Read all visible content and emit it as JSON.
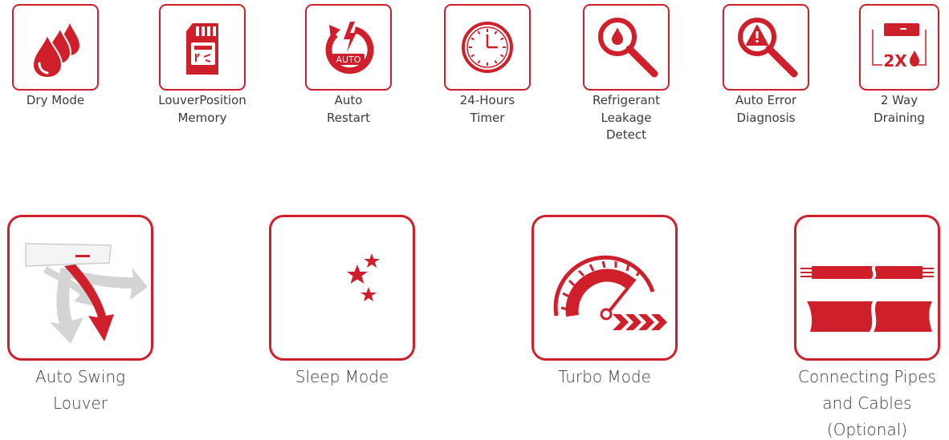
{
  "colors": {
    "accent": "#cf1f2b",
    "text": "#3a3a3a",
    "grey_arrow": "#d4d4d4"
  },
  "top_features": [
    {
      "icon": "water-drops-icon",
      "lines": [
        "Dry Mode"
      ]
    },
    {
      "icon": "memory-card-icon",
      "lines": [
        "LouverPosition",
        "Memory"
      ]
    },
    {
      "icon": "auto-restart-icon",
      "badge": "AUTO",
      "lines": [
        "Auto",
        "Restart"
      ]
    },
    {
      "icon": "clock-icon",
      "lines": [
        "24-Hours",
        "Timer"
      ]
    },
    {
      "icon": "leak-magnifier-icon",
      "lines": [
        "Refrigerant",
        "Leakage",
        "Detect"
      ]
    },
    {
      "icon": "error-magnifier-icon",
      "lines": [
        "Auto Error",
        "Diagnosis"
      ]
    },
    {
      "icon": "two-way-drain-icon",
      "badge": "2X",
      "lines": [
        "2 Way",
        "Draining"
      ]
    }
  ],
  "bottom_features": [
    {
      "icon": "swing-louver-icon",
      "lines": [
        "Auto Swing",
        "Louver"
      ]
    },
    {
      "icon": "moon-stars-icon",
      "lines": [
        "Sleep Mode"
      ]
    },
    {
      "icon": "speedometer-icon",
      "lines": [
        "Turbo Mode"
      ]
    },
    {
      "icon": "pipes-cables-icon",
      "lines": [
        "Connecting Pipes",
        "and Cables",
        "(Optional)"
      ]
    }
  ]
}
